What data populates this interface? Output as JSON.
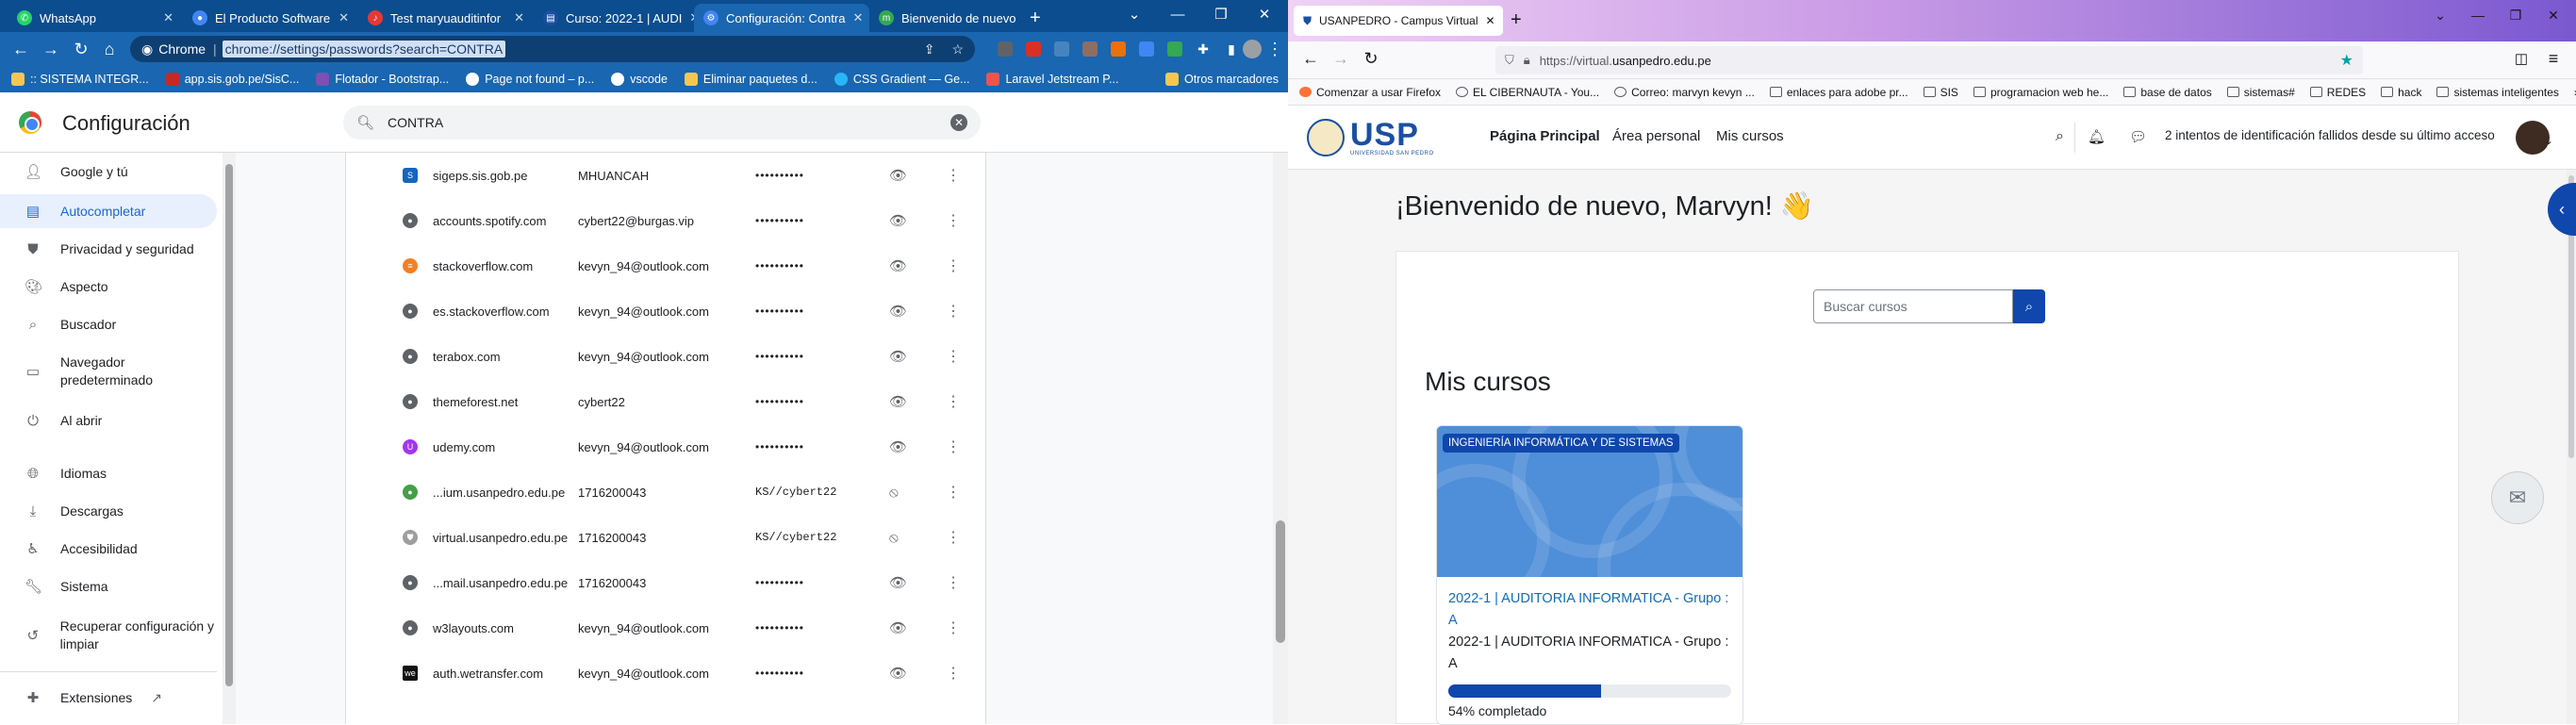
{
  "chrome": {
    "tabs": [
      {
        "label": "WhatsApp",
        "color": "#25d366"
      },
      {
        "label": "El Producto Software",
        "color": "#4285f4"
      },
      {
        "label": "Test maryuauditinfor",
        "color": "#e53935"
      },
      {
        "label": "Curso: 2022-1 | AUDI",
        "color": "#1a4fa3"
      },
      {
        "label": "Configuración: Contra",
        "color": "#4285f4"
      },
      {
        "label": "Bienvenido de nuevo",
        "color": "#34a853"
      }
    ],
    "omnibox": {
      "scheme": "Chrome",
      "url": "chrome://settings/passwords?search=CONTRA"
    },
    "bookmarks": [
      ":: SISTEMA INTEGR...",
      "app.sis.gob.pe/SisC...",
      "Flotador - Bootstrap...",
      "Page not found – p...",
      "vscode",
      "Eliminar paquetes d...",
      "CSS Gradient — Ge...",
      "Laravel Jetstream P...",
      "Otros marcadores"
    ],
    "settings": {
      "title": "Configuración",
      "search_value": "CONTRA",
      "sidebar": [
        {
          "label": "Google y tú",
          "icon": "person-icon"
        },
        {
          "label": "Autocompletar",
          "icon": "autofill-icon",
          "active": true
        },
        {
          "label": "Privacidad y seguridad",
          "icon": "shield-icon"
        },
        {
          "label": "Aspecto",
          "icon": "palette-icon"
        },
        {
          "label": "Buscador",
          "icon": "search-icon"
        },
        {
          "label": "Navegador predeterminado",
          "icon": "browser-icon"
        },
        {
          "label": "Al abrir",
          "icon": "power-icon"
        },
        {
          "label": "Idiomas",
          "icon": "globe-icon"
        },
        {
          "label": "Descargas",
          "icon": "download-icon"
        },
        {
          "label": "Accesibilidad",
          "icon": "accessibility-icon"
        },
        {
          "label": "Sistema",
          "icon": "wrench-icon"
        },
        {
          "label": "Recuperar configuración y limpiar",
          "icon": "restore-icon"
        },
        {
          "label": "Extensiones",
          "icon": "puzzle-icon"
        }
      ],
      "passwords": [
        {
          "site": "sigeps.sis.gob.pe",
          "user": "MHUANCAH",
          "password": "••••••••••",
          "revealed": false
        },
        {
          "site": "accounts.spotify.com",
          "user": "cybert22@burgas.vip",
          "password": "••••••••••",
          "revealed": false
        },
        {
          "site": "stackoverflow.com",
          "user": "kevyn_94@outlook.com",
          "password": "••••••••••",
          "revealed": false
        },
        {
          "site": "es.stackoverflow.com",
          "user": "kevyn_94@outlook.com",
          "password": "••••••••••",
          "revealed": false
        },
        {
          "site": "terabox.com",
          "user": "kevyn_94@outlook.com",
          "password": "••••••••••",
          "revealed": false
        },
        {
          "site": "themeforest.net",
          "user": "cybert22",
          "password": "••••••••••",
          "revealed": false
        },
        {
          "site": "udemy.com",
          "user": "kevyn_94@outlook.com",
          "password": "••••••••••",
          "revealed": false
        },
        {
          "site": "...ium.usanpedro.edu.pe",
          "user": "1716200043",
          "password": "KS//cybert22",
          "revealed": true
        },
        {
          "site": "virtual.usanpedro.edu.pe",
          "user": "1716200043",
          "password": "KS//cybert22",
          "revealed": true
        },
        {
          "site": "...mail.usanpedro.edu.pe",
          "user": "1716200043",
          "password": "••••••••••",
          "revealed": false
        },
        {
          "site": "w3layouts.com",
          "user": "kevyn_94@outlook.com",
          "password": "••••••••••",
          "revealed": false
        },
        {
          "site": "auth.wetransfer.com",
          "user": "kevyn_94@outlook.com",
          "password": "••••••••••",
          "revealed": false
        }
      ]
    }
  },
  "firefox": {
    "tab_label": "USANPEDRO - Campus Virtual",
    "url_prefix": "https://virtual.",
    "url_domain": "usanpedro.edu.pe",
    "bookmarks": [
      "Comenzar a usar Firefox",
      "EL CIBERNAUTA - You...",
      "Correo: marvyn kevyn ...",
      "enlaces para adobe pr...",
      "SIS",
      "programacion web he...",
      "base de datos",
      "sistemas#",
      "REDES",
      "hack",
      "sistemas inteligentes"
    ],
    "site": {
      "logo_text": "USP",
      "logo_subtext": "UNIVERSIDAD SAN PEDRO",
      "nav": [
        "Página Principal",
        "Área personal",
        "Mis cursos"
      ],
      "alert": "2 intentos de identificación fallidos desde su último acceso",
      "welcome": "¡Bienvenido de nuevo, Marvyn! 👋",
      "search_placeholder": "Buscar cursos",
      "my_courses_title": "Mis cursos",
      "course": {
        "category": "INGENIERÍA INFORMÁTICA Y DE SISTEMAS",
        "link": "2022-1 | AUDITORIA INFORMATICA - Grupo : A",
        "name": "2022-1 | AUDITORIA INFORMATICA - Grupo : A",
        "progress_pct": 54,
        "progress_text": "54% completado"
      }
    }
  }
}
